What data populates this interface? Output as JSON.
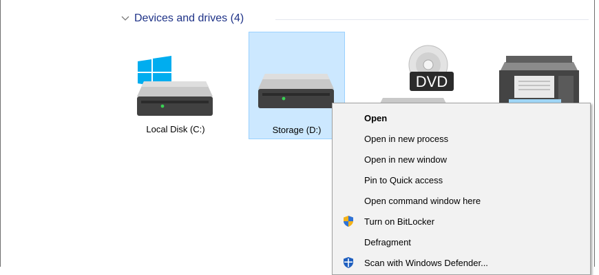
{
  "group": {
    "title": "Devices and drives (4)",
    "chevron_icon": "chevron-down-icon"
  },
  "drives": [
    {
      "label": "Local Disk (C:)",
      "icon": "windows-drive-icon",
      "selected": false
    },
    {
      "label": "Storage (D:)",
      "icon": "hard-drive-icon",
      "selected": true
    },
    {
      "label": "",
      "icon": "dvd-drive-icon",
      "selected": false
    },
    {
      "label": "",
      "icon": "printer-icon",
      "selected": false
    }
  ],
  "context_menu": {
    "items": [
      {
        "label": "Open",
        "bold": true,
        "icon": ""
      },
      {
        "label": "Open in new process",
        "bold": false,
        "icon": ""
      },
      {
        "label": "Open in new window",
        "bold": false,
        "icon": ""
      },
      {
        "label": "Pin to Quick access",
        "bold": false,
        "icon": ""
      },
      {
        "label": "Open command window here",
        "bold": false,
        "icon": ""
      },
      {
        "label": "Turn on BitLocker",
        "bold": false,
        "icon": "uac-shield-icon"
      },
      {
        "label": "Defragment",
        "bold": false,
        "icon": ""
      },
      {
        "label": "Scan with Windows Defender...",
        "bold": false,
        "icon": "windows-defender-icon"
      }
    ]
  },
  "colors": {
    "group_title": "#1e3287",
    "selection_fill": "#cce8ff",
    "selection_border": "#99d1ff",
    "menu_background": "#f2f2f2"
  }
}
